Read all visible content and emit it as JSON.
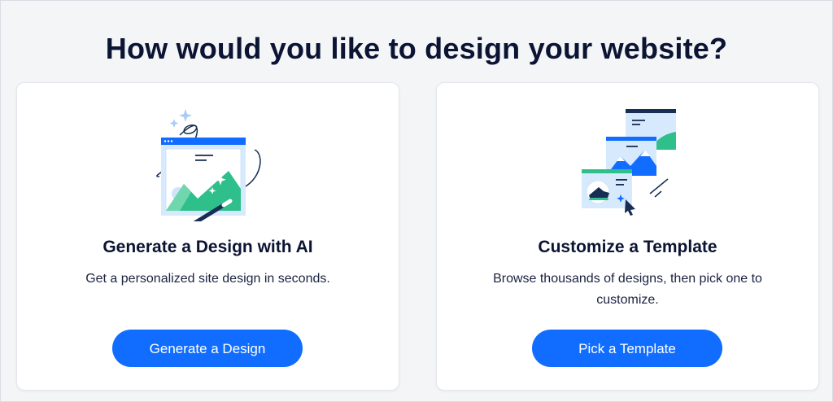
{
  "page": {
    "title": "How would you like to design your website?"
  },
  "options": [
    {
      "title": "Generate a Design with AI",
      "description": "Get a personalized site design in seconds.",
      "button_label": "Generate a Design",
      "illustration": "ai-design-illustration"
    },
    {
      "title": "Customize a Template",
      "description": "Browse thousands of designs, then pick one to customize.",
      "button_label": "Pick a Template",
      "illustration": "template-illustration"
    }
  ],
  "colors": {
    "accent": "#116dff",
    "illustration_green": "#2fbf8a",
    "illustration_light_blue": "#cfe4fb",
    "illustration_dark": "#162d54",
    "background": "#f4f5f7",
    "card": "#ffffff"
  }
}
